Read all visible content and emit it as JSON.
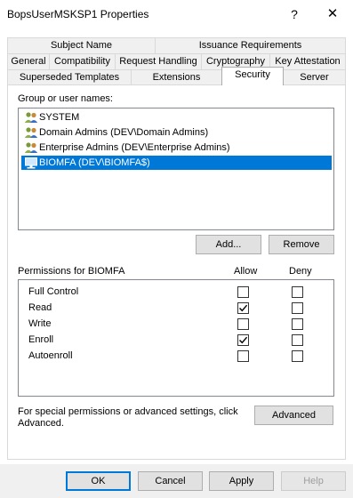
{
  "window": {
    "title": "BopsUserMSKSP1 Properties",
    "help_glyph": "?",
    "close_glyph": "✕"
  },
  "tabs": {
    "row1": [
      "Subject Name",
      "Issuance Requirements"
    ],
    "row2": [
      "General",
      "Compatibility",
      "Request Handling",
      "Cryptography",
      "Key Attestation"
    ],
    "row3": [
      "Superseded Templates",
      "Extensions",
      "Security",
      "Server"
    ],
    "active": "Security"
  },
  "security": {
    "group_label": "Group or user names:",
    "principals": [
      {
        "name": "SYSTEM",
        "icon": "user-group-icon",
        "selected": false
      },
      {
        "name": "Domain Admins (DEV\\Domain Admins)",
        "icon": "user-group-icon",
        "selected": false
      },
      {
        "name": "Enterprise Admins (DEV\\Enterprise Admins)",
        "icon": "user-group-icon",
        "selected": false
      },
      {
        "name": "BIOMFA (DEV\\BIOMFA$)",
        "icon": "computer-icon",
        "selected": true
      }
    ],
    "add_label": "Add...",
    "remove_label": "Remove",
    "permissions_for_label": "Permissions for BIOMFA",
    "allow_label": "Allow",
    "deny_label": "Deny",
    "permissions": [
      {
        "name": "Full Control",
        "allow": false,
        "deny": false
      },
      {
        "name": "Read",
        "allow": true,
        "deny": false
      },
      {
        "name": "Write",
        "allow": false,
        "deny": false
      },
      {
        "name": "Enroll",
        "allow": true,
        "deny": false
      },
      {
        "name": "Autoenroll",
        "allow": false,
        "deny": false
      }
    ],
    "advanced_text_line1": "For special permissions or advanced settings, click",
    "advanced_text_line2": "Advanced.",
    "advanced_label": "Advanced"
  },
  "footer": {
    "ok_label": "OK",
    "cancel_label": "Cancel",
    "apply_label": "Apply",
    "help_label": "Help",
    "help_enabled": false
  },
  "colors": {
    "selection": "#0078d7",
    "default_button_border": "#0078d7",
    "disabled_text": "#9d9d9d"
  }
}
